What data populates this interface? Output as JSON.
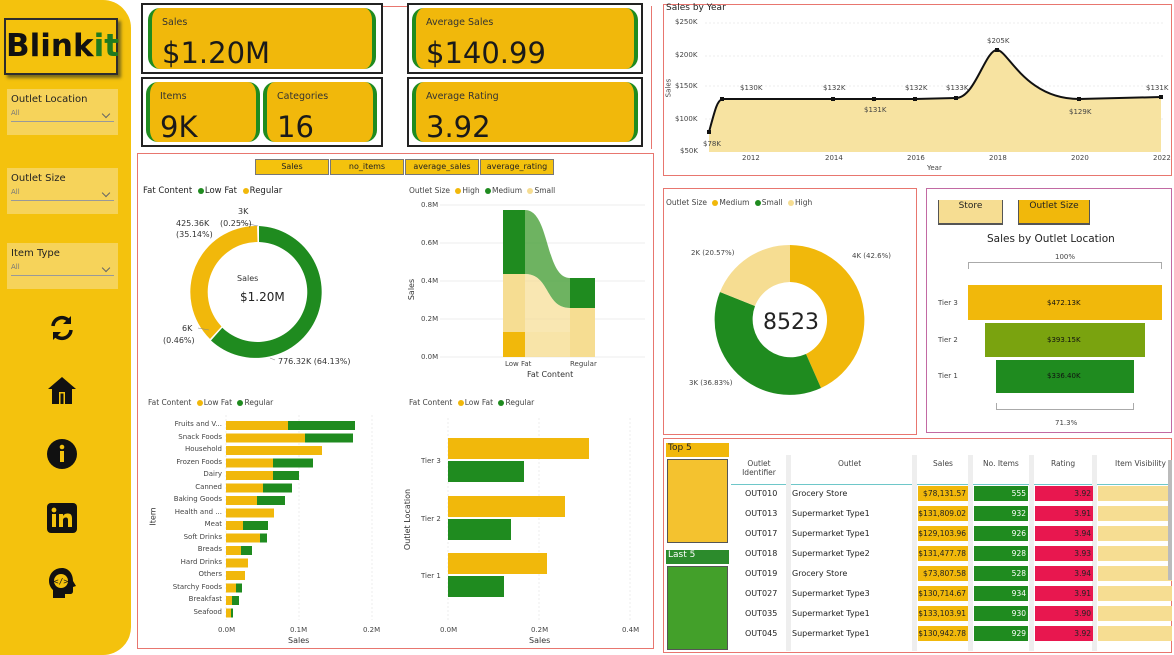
{
  "brand": {
    "name_main": "Blink",
    "name_accent": "it"
  },
  "slicers": [
    {
      "label": "Outlet Location",
      "value": "All"
    },
    {
      "label": "Outlet Size",
      "value": "All"
    },
    {
      "label": "Item Type",
      "value": "All"
    }
  ],
  "nav_icons": [
    "refresh-icon",
    "home-icon",
    "info-icon",
    "linkedin-icon",
    "developer-icon"
  ],
  "kpis": {
    "sales": {
      "title": "Sales",
      "value": "$1.20M"
    },
    "avg_sales": {
      "title": "Average Sales",
      "value": "$140.99"
    },
    "items": {
      "title": "Items",
      "value": "9K"
    },
    "categories": {
      "title": "Categories",
      "value": "16"
    },
    "avg_rating": {
      "title": "Average Rating",
      "value": "3.92"
    }
  },
  "metric_buttons": [
    "Sales",
    "no_items",
    "average_sales",
    "average_rating"
  ],
  "colors": {
    "yellow": "#f1b80b",
    "green": "#1f8b1f",
    "light_yellow": "#f6dd92",
    "lime": "#7aa30f",
    "red": "#e8174f",
    "panel_border": "#e8766f"
  },
  "fat_donut": {
    "legend_title": "Fat Content",
    "legend": [
      "Low Fat",
      "Regular"
    ],
    "center_label": "Sales",
    "center_value": "$1.20M",
    "labels": {
      "regular": "425.36K\n(35.14%)",
      "low_fat": "776.32K (64.13%)",
      "a": "3K",
      "a_pct": "(0.25%)",
      "b": "6K",
      "b_pct": "(0.46%)"
    }
  },
  "ribbon": {
    "legend_title": "Outlet Size",
    "legend": [
      "High",
      "Medium",
      "Small"
    ],
    "xlabel": "Fat Content",
    "ylabel": "Sales",
    "x_ticks": [
      "Low Fat",
      "Regular"
    ],
    "y_ticks": [
      "0.8M",
      "0.6M",
      "0.4M",
      "0.2M",
      "0.0M"
    ]
  },
  "item_bars": {
    "legend_title": "Fat Content",
    "legend": [
      "Low Fat",
      "Regular"
    ],
    "ylabel": "Item",
    "xlabel": "Sales",
    "x_ticks": [
      "0.0M",
      "0.1M",
      "0.2M"
    ],
    "items": [
      "Fruits and V...",
      "Snack Foods",
      "Household",
      "Frozen Foods",
      "Dairy",
      "Canned",
      "Baking Goods",
      "Health and ...",
      "Meat",
      "Soft Drinks",
      "Breads",
      "Hard Drinks",
      "Others",
      "Starchy Foods",
      "Breakfast",
      "Seafood"
    ]
  },
  "tier_bars": {
    "legend_title": "Fat Content",
    "legend": [
      "Low Fat",
      "Regular"
    ],
    "ylabel": "Outlet Location",
    "xlabel": "Sales",
    "tiers": [
      "Tier 3",
      "Tier 2",
      "Tier 1"
    ],
    "x_ticks": [
      "0.0M",
      "0.2M",
      "0.4M"
    ]
  },
  "year_line": {
    "title": "Sales by Year",
    "xlabel": "Year",
    "ylabel": "Sales",
    "y_ticks": [
      "$250K",
      "$200K",
      "$150K",
      "$100K",
      "$50K"
    ],
    "x_ticks": [
      "2012",
      "2014",
      "2016",
      "2018",
      "2020",
      "2022"
    ],
    "point_labels": [
      "$78K",
      "$130K",
      "$132K",
      "$131K",
      "$132K",
      "$133K",
      "$205K",
      "$129K",
      "$131K"
    ]
  },
  "size_donut": {
    "legend_title": "Outlet Size",
    "legend": [
      "Medium",
      "Small",
      "High"
    ],
    "center": "8523",
    "labels": {
      "a": "2K (20.57%)",
      "b": "4K (42.6%)",
      "c": "3K (36.83%)"
    }
  },
  "funnel": {
    "tabs": [
      "Store",
      "Outlet Size"
    ],
    "title": "Sales by Outlet Location",
    "top_pct": "100%",
    "bottom_pct": "71.3%",
    "tiers": [
      {
        "name": "Tier 3",
        "value": "$472.13K"
      },
      {
        "name": "Tier 2",
        "value": "$393.15K"
      },
      {
        "name": "Tier 1",
        "value": "$336.40K"
      }
    ]
  },
  "toplist": {
    "top": "Top 5",
    "last": "Last 5"
  },
  "table": {
    "headers": [
      "Outlet\nIdentifier",
      "Outlet",
      "Sales",
      "No. Items",
      "Rating",
      "Item Visibility"
    ],
    "rows": [
      [
        "OUT010",
        "Grocery Store",
        "$78,131.57",
        "555",
        "3.92"
      ],
      [
        "OUT013",
        "Supermarket Type1",
        "$131,809.02",
        "932",
        "3.91"
      ],
      [
        "OUT017",
        "Supermarket Type1",
        "$129,103.96",
        "926",
        "3.94"
      ],
      [
        "OUT018",
        "Supermarket Type2",
        "$131,477.78",
        "928",
        "3.93"
      ],
      [
        "OUT019",
        "Grocery Store",
        "$73,807.58",
        "528",
        "3.94"
      ],
      [
        "OUT027",
        "Supermarket Type3",
        "$130,714.67",
        "934",
        "3.91"
      ],
      [
        "OUT035",
        "Supermarket Type1",
        "$133,103.91",
        "930",
        "3.90"
      ],
      [
        "OUT045",
        "Supermarket Type1",
        "$130,942.78",
        "929",
        "3.92"
      ]
    ]
  }
}
